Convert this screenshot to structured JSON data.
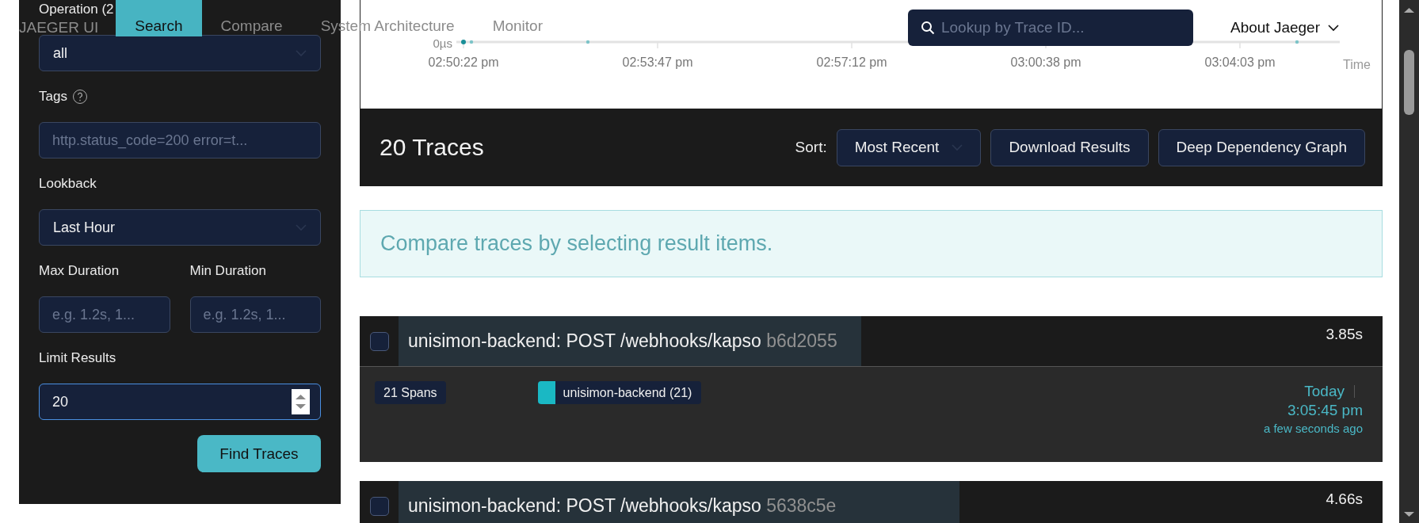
{
  "nav": {
    "brand": "JAEGER UI",
    "tabs": [
      {
        "label": "Search",
        "selected": true
      },
      {
        "label": "Compare",
        "selected": false
      },
      {
        "label": "System Architecture",
        "selected": false
      },
      {
        "label": "Monitor",
        "selected": false
      }
    ],
    "search": {
      "placeholder": "Lookup by Trace ID..."
    },
    "menu": {
      "label": "About Jaeger"
    }
  },
  "sidebar": {
    "fields": [
      {
        "kind": "select",
        "label": "Operation (2",
        "value": "all"
      },
      {
        "kind": "text",
        "label": "Tags",
        "help": true,
        "placeholder": "http.status_code=200 error=t..."
      },
      {
        "kind": "select",
        "label": "Lookback",
        "value": "Last Hour"
      },
      {
        "kind": "pair",
        "fields": [
          {
            "label": "Max Duration",
            "placeholder": "e.g. 1.2s, 1..."
          },
          {
            "label": "Min Duration",
            "placeholder": "e.g. 1.2s, 1..."
          }
        ]
      },
      {
        "kind": "number",
        "label": "Limit Results",
        "value": "20",
        "focused": true
      }
    ],
    "submit": "Find Traces"
  },
  "timeline": {
    "y_label": "0µs",
    "x_labels": [
      "02:50:22 pm",
      "02:53:47 pm",
      "02:57:12 pm",
      "03:00:38 pm",
      "03:04:03 pm"
    ],
    "x_title": "Time"
  },
  "results": {
    "title": "20 Traces",
    "sort": {
      "label": "Sort:",
      "value": "Most Recent"
    },
    "buttons": [
      "Download Results",
      "Deep Dependency Graph"
    ],
    "compare_hint": "Compare traces by selecting result items."
  },
  "traces": [
    {
      "title": "unisimon-backend: POST /webhooks/kapso",
      "id": "b6d2055",
      "duration": "3.85s",
      "level": 0.47,
      "checked": false,
      "spans": "21 Spans",
      "services": [
        {
          "name": "unisimon-backend (21)",
          "color": "#1ab8c4"
        }
      ],
      "date": "Today",
      "time": "3:05:45 pm",
      "ago": "a few seconds ago"
    },
    {
      "title": "unisimon-backend: POST /webhooks/kapso",
      "id": "5638c5e",
      "duration": "4.66s",
      "level": 0.57,
      "checked": false
    }
  ]
}
